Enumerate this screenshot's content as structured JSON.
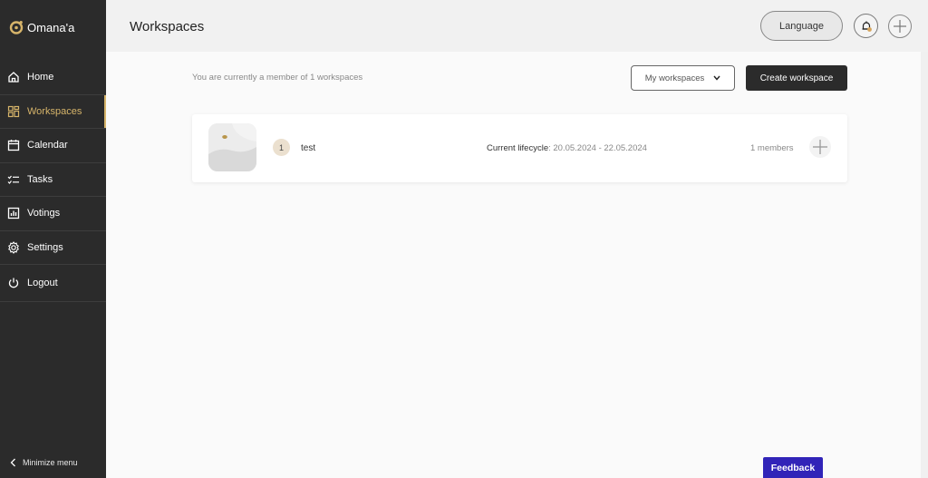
{
  "app": {
    "name": "Omana'a",
    "accent": "#d6b46a"
  },
  "sidebar": {
    "items": [
      {
        "label": "Home",
        "icon": "home-icon"
      },
      {
        "label": "Workspaces",
        "icon": "workspaces-icon",
        "active": true
      },
      {
        "label": "Calendar",
        "icon": "calendar-icon"
      },
      {
        "label": "Tasks",
        "icon": "tasks-icon"
      },
      {
        "label": "Votings",
        "icon": "votings-icon"
      },
      {
        "label": "Settings",
        "icon": "gear-icon"
      },
      {
        "label": "Logout",
        "icon": "power-icon"
      }
    ],
    "minimize_label": "Minimize menu"
  },
  "header": {
    "title": "Workspaces",
    "language_label": "Language"
  },
  "main": {
    "member_text": "You are currently a member of 1 workspaces",
    "filter_value": "My workspaces",
    "create_label": "Create workspace",
    "workspaces": [
      {
        "index": "1",
        "name": "test",
        "lifecycle_label": "Current lifecycle",
        "lifecycle_range": ": 20.05.2024 - 22.05.2024",
        "members": "1 members"
      }
    ]
  },
  "feedback_label": "Feedback"
}
